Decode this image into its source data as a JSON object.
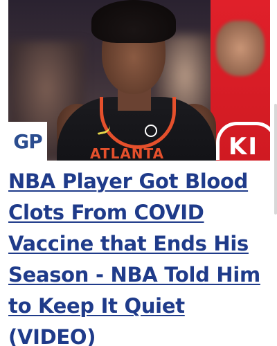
{
  "article": {
    "source_logo": "GP",
    "image": {
      "jersey_text": "ATLANTA",
      "banner_text": "KI"
    },
    "headline_lines": [
      "NBA Player Got Blood",
      "Clots From COVID",
      "Vaccine that Ends His",
      "Season - NBA Told Him",
      "to Keep It Quiet",
      "(VIDEO)"
    ]
  },
  "colors": {
    "link": "#1f3b8a",
    "logo": "#2b4d8f",
    "jersey_accent": "#e5502c",
    "banner_red": "#e0202a"
  }
}
